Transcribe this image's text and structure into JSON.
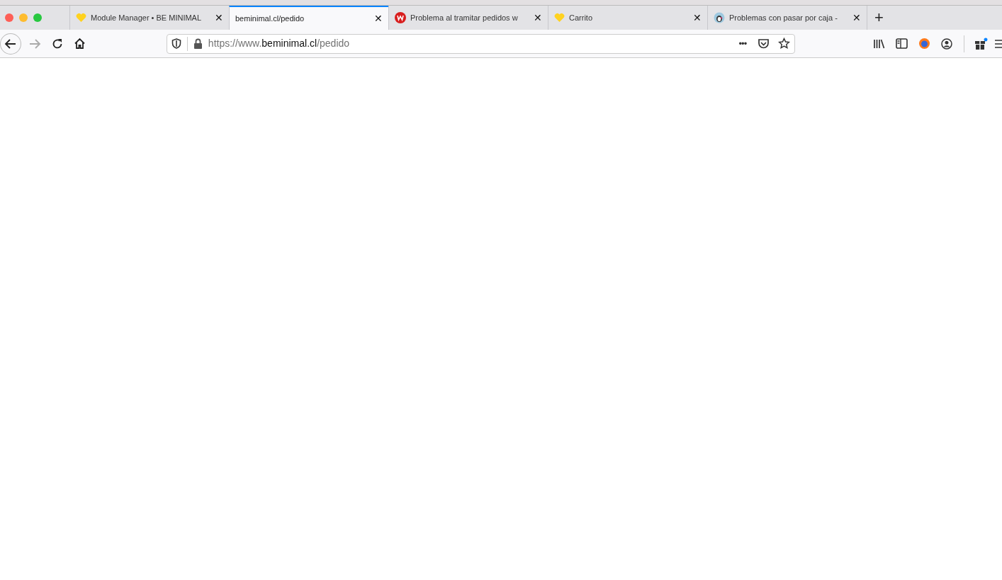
{
  "tabs": [
    {
      "kind": "heart",
      "title": "Module Manager • BE MINIMAL",
      "close": "✕",
      "selected": false
    },
    {
      "kind": "plain",
      "title": "beminimal.cl/pedido",
      "close": "✕",
      "selected": true
    },
    {
      "kind": "w",
      "title": "Problema al tramitar pedidos w",
      "close": "✕",
      "selected": false
    },
    {
      "kind": "heart",
      "title": "Carrito",
      "close": "✕",
      "selected": false
    },
    {
      "kind": "bird",
      "title": "Problemas con pasar por caja -",
      "close": "✕",
      "selected": false
    }
  ],
  "new_tab": "+",
  "address": {
    "prefix": "https://www.",
    "domain": "beminimal.cl",
    "path": "/pedido"
  },
  "page_actions": "•••"
}
